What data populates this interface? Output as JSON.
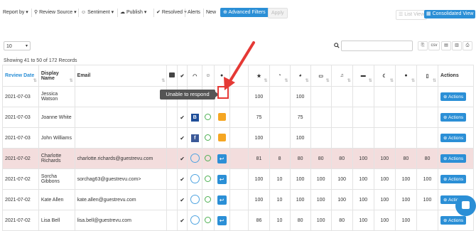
{
  "toolbar": {
    "report_by": "Report by",
    "review_source": "Review Source",
    "sentiment": "Sentiment",
    "publish": "Publish",
    "resolved": "Resolved",
    "alerts": "Alerts",
    "new": "New",
    "advanced_filters": "Advanced Filters",
    "apply": "Apply",
    "list_view": "List View",
    "consolidated_view": "Consolidated View"
  },
  "controls": {
    "page_size": "10",
    "search_value": "",
    "export_csv": "csv"
  },
  "showing": "Showing 41 to 50 of 172 Records",
  "headers": {
    "review_date": "Review Date",
    "display_name": "Display Name",
    "email": "Email",
    "actions": "Actions"
  },
  "tooltip": "Unable to respond",
  "actions_label": "Actions",
  "rows": [
    {
      "date": "2021-07-03",
      "name": "Jessica Watson",
      "email": "",
      "check": false,
      "source": "",
      "reply": "none",
      "c1": "100",
      "c2": "",
      "c3": "100",
      "c4": "",
      "c5": "",
      "c6": "",
      "c7": "",
      "c8": "",
      "c9": "",
      "highlight": false
    },
    {
      "date": "2021-07-03",
      "name": "Joanne White",
      "email": "",
      "check": true,
      "source": "B",
      "reply": "note",
      "c1": "75",
      "c2": "",
      "c3": "75",
      "c4": "",
      "c5": "",
      "c6": "",
      "c7": "",
      "c8": "",
      "c9": "",
      "highlight": false
    },
    {
      "date": "2021-07-03",
      "name": "John Williams",
      "email": "",
      "check": true,
      "source": "F",
      "reply": "note",
      "c1": "100",
      "c2": "",
      "c3": "100",
      "c4": "",
      "c5": "",
      "c6": "",
      "c7": "",
      "c8": "",
      "c9": "",
      "highlight": false
    },
    {
      "date": "2021-07-02",
      "name": "Charlotte Richards",
      "email": "charlotte.richards@guestrevu.com",
      "check": true,
      "source": "G",
      "reply": "reply",
      "c1": "81",
      "c2": "8",
      "c3": "80",
      "c4": "80",
      "c5": "80",
      "c6": "100",
      "c7": "100",
      "c8": "80",
      "c9": "80",
      "highlight": true
    },
    {
      "date": "2021-07-02",
      "name": "Sorcha Gibbons",
      "email": "sorchag63@guestrevu.com>",
      "check": true,
      "source": "G",
      "reply": "reply",
      "c1": "100",
      "c2": "10",
      "c3": "100",
      "c4": "100",
      "c5": "100",
      "c6": "100",
      "c7": "100",
      "c8": "100",
      "c9": "100",
      "highlight": false
    },
    {
      "date": "2021-07-02",
      "name": "Kate Allen",
      "email": "kate.allen@guestrevu.com",
      "check": true,
      "source": "G",
      "reply": "reply",
      "c1": "100",
      "c2": "10",
      "c3": "100",
      "c4": "100",
      "c5": "100",
      "c6": "100",
      "c7": "100",
      "c8": "100",
      "c9": "100",
      "highlight": false
    },
    {
      "date": "2021-07-02",
      "name": "Lisa Bell",
      "email": "lisa.bell@guestrevu.com",
      "check": true,
      "source": "G",
      "reply": "reply",
      "c1": "86",
      "c2": "10",
      "c3": "80",
      "c4": "100",
      "c5": "80",
      "c6": "100",
      "c7": "100",
      "c8": "100",
      "c9": "",
      "highlight": false
    }
  ]
}
